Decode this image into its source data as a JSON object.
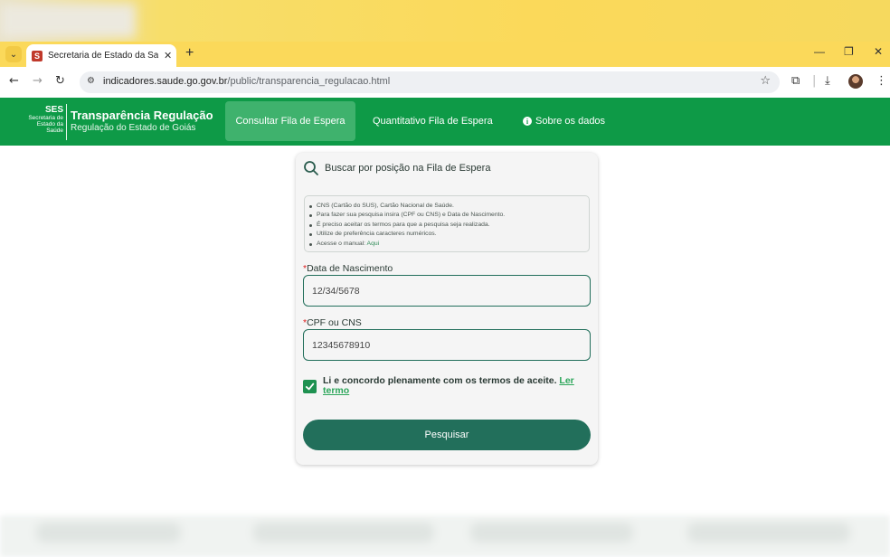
{
  "browser": {
    "tab_title": "Secretaria de Estado da SaÃºde",
    "favicon_letter": "S",
    "tab_close_glyph": "✕",
    "new_tab_glyph": "+",
    "url_host": "indicadores.saude.go.gov.br",
    "url_path": "/public/transparencia_regulacao.html",
    "window_controls": [
      "—",
      "❐",
      "✕"
    ]
  },
  "header": {
    "logo_abbr": "SES",
    "logo_full_lines": [
      "Secretaria de",
      "Estado da",
      "Saúde"
    ],
    "title": "Transparência Regulação",
    "subtitle": "Regulação do Estado de Goiás",
    "nav": [
      {
        "label": "Consultar Fila de Espera",
        "active": true
      },
      {
        "label": "Quantitativo Fila de Espera",
        "active": false
      },
      {
        "label": "Sobre os dados",
        "active": false,
        "icon": "info-icon"
      }
    ],
    "color": "#0e9a47"
  },
  "card": {
    "title": "Buscar por posição na Fila de Espera",
    "info_items": [
      "CNS (Cartão do SUS), Cartão Nacional de Saúde.",
      "Para fazer sua pesquisa insira (CPF ou CNS) e Data de Nascimento.",
      "É preciso aceitar os termos para que a pesquisa seja realizada.",
      "Utilize de preferência caracteres numéricos."
    ],
    "manual_prefix": "Acesse o manual: ",
    "manual_link": "Aqui",
    "required_mark": "*",
    "birth_label": "Data de Nascimento",
    "birth_value": "12/34/5678",
    "doc_label": "CPF ou CNS",
    "doc_value": "12345678910",
    "terms_checked": true,
    "terms_text": "Li e concordo plenamente com os termos de aceite. ",
    "terms_link": "Ler termo",
    "submit_label": "Pesquisar",
    "accent": "#226f5b"
  }
}
